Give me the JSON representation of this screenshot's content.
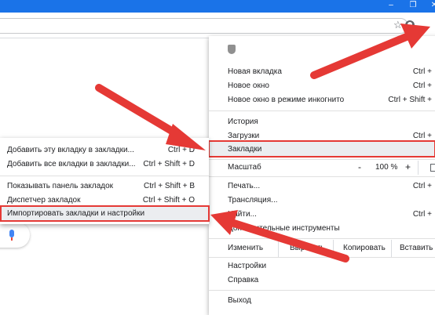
{
  "titlebar": {
    "restore_glyph": "❐",
    "close_glyph": "✕"
  },
  "toolbar": {
    "bookmark_glyph": "☆"
  },
  "main_menu": {
    "items": [
      {
        "label": "Новая вкладка",
        "shortcut": "Ctrl +"
      },
      {
        "label": "Новое окно",
        "shortcut": "Ctrl +"
      },
      {
        "label": "Новое окно в режиме инкогнито",
        "shortcut": "Ctrl + Shift +"
      },
      {
        "label": "История",
        "shortcut": ""
      },
      {
        "label": "Загрузки",
        "shortcut": "Ctrl +"
      },
      {
        "label": "Закладки",
        "shortcut": ""
      },
      {
        "label": "Печать...",
        "shortcut": "Ctrl +"
      },
      {
        "label": "Трансляция...",
        "shortcut": ""
      },
      {
        "label": "Найти...",
        "shortcut": "Ctrl +"
      },
      {
        "label": "Дополнительные инструменты",
        "shortcut": ""
      },
      {
        "label": "Настройки",
        "shortcut": ""
      },
      {
        "label": "Справка",
        "shortcut": ""
      },
      {
        "label": "Выход",
        "shortcut": ""
      }
    ],
    "zoom": {
      "label": "Масштаб",
      "minus": "-",
      "value": "100 %",
      "plus": "+"
    },
    "edit": {
      "label": "Изменить",
      "cut": "Вырезать",
      "copy": "Копировать",
      "paste": "Вставить"
    }
  },
  "sub_menu": {
    "items": [
      {
        "label": "Добавить эту вкладку в закладки...",
        "shortcut": "Ctrl + D"
      },
      {
        "label": "Добавить все вкладки в закладки...",
        "shortcut": "Ctrl + Shift + D"
      },
      {
        "label": "Показывать панель закладок",
        "shortcut": "Ctrl + Shift + B"
      },
      {
        "label": "Диспетчер закладок",
        "shortcut": "Ctrl + Shift + O"
      },
      {
        "label": "Импортировать закладки и настройки",
        "shortcut": ""
      }
    ]
  },
  "colors": {
    "accent": "#1a73e8",
    "highlight": "#e53935"
  }
}
